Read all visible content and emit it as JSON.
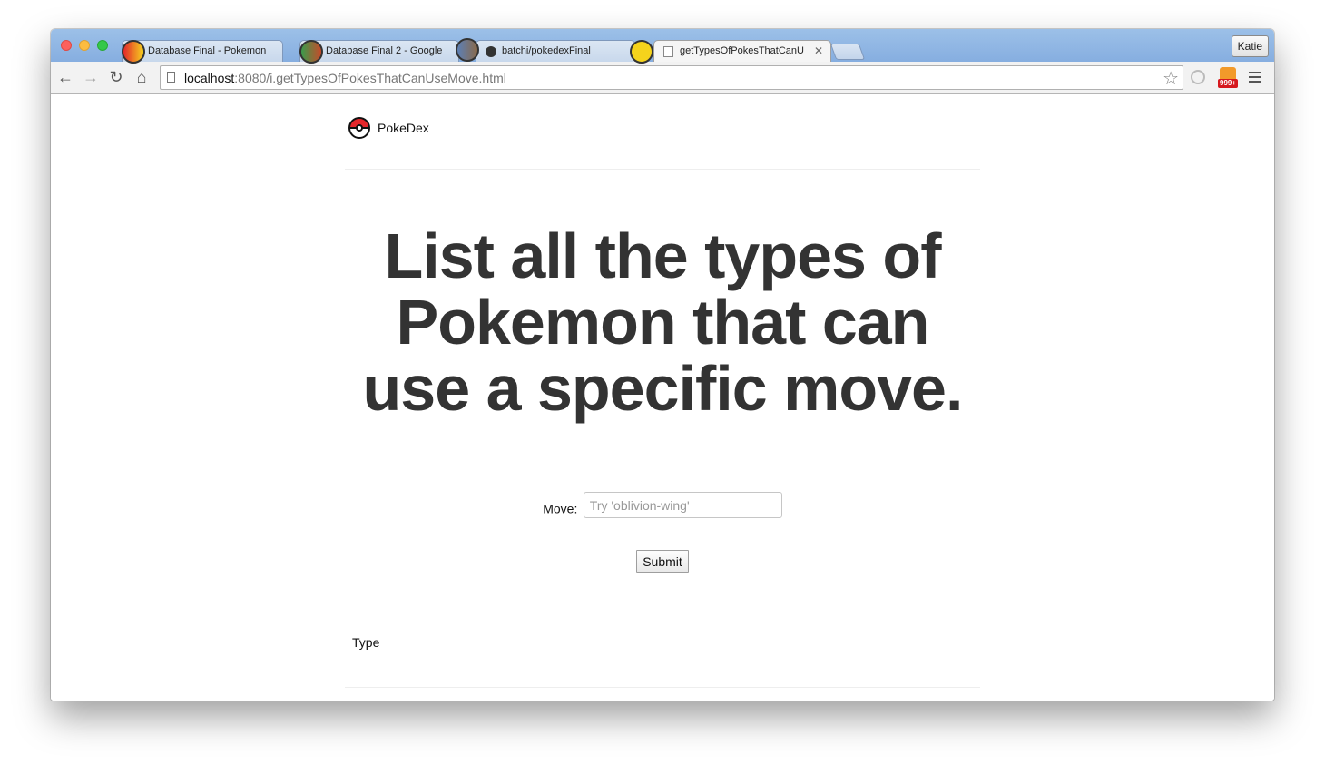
{
  "browser": {
    "tabs": [
      {
        "label": "Database Final - Pokemon",
        "icon": "google-docs-icon",
        "active": false
      },
      {
        "label": "Database Final 2 - Google",
        "icon": "google-docs-icon",
        "active": false
      },
      {
        "label": "batchi/pokedexFinal",
        "icon": "github-icon",
        "active": false
      },
      {
        "label": "getTypesOfPokesThatCanU",
        "icon": "page-icon",
        "active": true
      }
    ],
    "profile_name": "Katie",
    "address_bar": {
      "host": "localhost",
      "path": ":8080/i.getTypesOfPokesThatCanUseMove.html"
    },
    "rss_badge": "999+"
  },
  "page": {
    "brand": "PokeDex",
    "headline": "List all the types of Pokemon that can use a specific move.",
    "form": {
      "move_label": "Move:",
      "move_placeholder": "Try 'oblivion-wing'",
      "move_value": "",
      "submit_label": "Submit"
    },
    "results": {
      "column_header": "Type"
    }
  },
  "colors": {
    "tabstrip": "#8fb6e2",
    "headline_text": "#333333",
    "pokeball_red": "#e3262a"
  }
}
